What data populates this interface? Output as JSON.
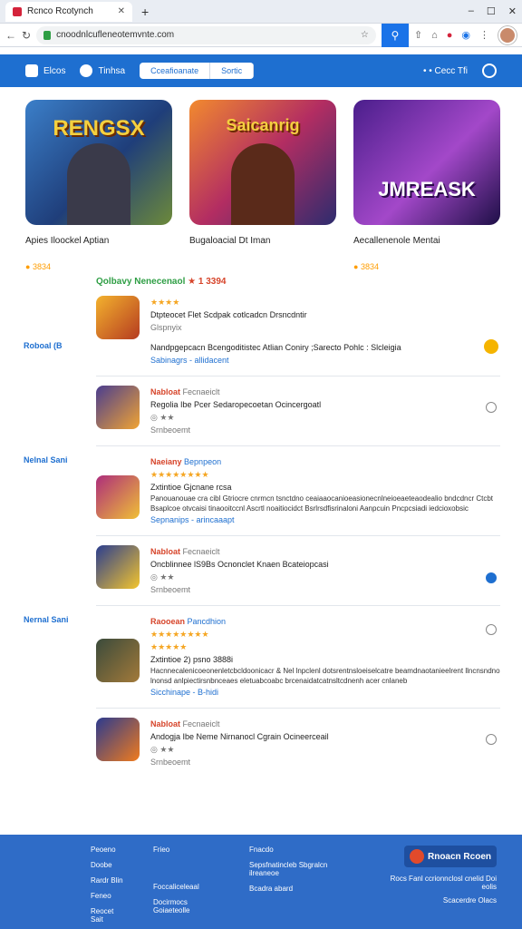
{
  "browser": {
    "tab_title": "Rcnco Rcotynch",
    "url": "cnoodnlcufleneotemvnte.com"
  },
  "appbar": {
    "brand": "Elcos",
    "nav_home": "Tinhsa",
    "seg_left": "Cceafioanate",
    "seg_right": "Sortic",
    "right_text": "• • Cecc Tfi"
  },
  "featured": [
    {
      "art_title": "RENGSX",
      "name": "Apies Iloockel Aptian",
      "rating": "3834"
    },
    {
      "art_title": "Saicanrig",
      "name": "Bugaloacial Dt Iman",
      "rating": "1 3394"
    },
    {
      "art_title": "JMREASK",
      "name": "Aecallenenole Mentai",
      "rating": "3834"
    }
  ],
  "section_title": "Qolbavy Nenecenaol",
  "rows": [
    {
      "side": "",
      "name": "Dtpteocet Flet Scdpak cotlcadcn Drsncdntir",
      "meta1": "★★★★",
      "sub": "Glspnyix",
      "side_label": "Roboal (B",
      "desc": "Nandpgepcacn Bcengoditistec Atlian Coniry ;Sarecto Pohlc : Slcleigia",
      "link": "Sabinagrs - allidacent"
    },
    {
      "side": "",
      "tag": "Nabloat",
      "tag2": "Fecnaeiclt",
      "name": "Regolia Ibe Pcer Sedaropecoetan Ocincergoatl",
      "sub": "Srnbeoemt"
    },
    {
      "side": "Nelnal Sani",
      "tag": "Naeiany",
      "tag2": "Bepnpeon",
      "name": "Zxtintioe Gjcnane rcsa",
      "desc": "Panouanouae cra cibl Gtriocre cnrmcn tsnctdno ceaiaaocanioeasionecnlneioeaeteaodealio bndcdncr Ctcbt Bsaplcoe otvcaisi tinaooitccnl Ascrtl noaitiocidct Bsrlrsdfisrinaloni Aanpcuin Pncpcsiadi iedcioxobsic",
      "link": "Sepnanips - arincaaapt"
    },
    {
      "side": "",
      "tag": "Nabloat",
      "tag2": "Fecnaeiclt",
      "name": "Oncblinnee lS9Bs Ocnonclet Knaen Bcateiopcasi",
      "sub": "Srnbeoemt"
    },
    {
      "side": "Nernal Sani",
      "tag": "Raooean",
      "tag2": "Pancdhion",
      "name": "Zxtintioe 2) psno 3888i",
      "desc": "Hacnnecalenicoeonenletcbcldoonicacr & Nel lnpclenl dotsrentnsloeiselcatre beamdnaotanieelrent llncnsndno lnonsd anlpiectirsnbnceaes eletuabcoabc brcenaidatcatnsltcdnenh acer cnlaneb",
      "link": "Sicchinape - B-hidi"
    },
    {
      "side": "",
      "tag": "Nabloat",
      "tag2": "Fecnaeiclt",
      "name": "Andogja Ibe Neme Nirnanocl Cgrain Ocineerceail",
      "sub": "Srnbeoemt"
    }
  ],
  "footer": {
    "col1": [
      "Peoeno",
      "Doobe",
      "Rardr Blin",
      "Feneo",
      "Reocet Sait"
    ],
    "col2": [
      "Frieo",
      "",
      "",
      "Foccaliceleaal",
      "Docirmocs Goiaeteolle"
    ],
    "col3": [
      "Fnacdo",
      "Sepsfnatincleb Sbgralcn ilreaneoe",
      "Bcadra abard"
    ],
    "brand": "Rnoacn Rcoen",
    "brand_sub": "Rocs Fanl ccrionnclosl cnelid Doi eolis",
    "brand_sub2": "Scacerdre Olacs"
  }
}
